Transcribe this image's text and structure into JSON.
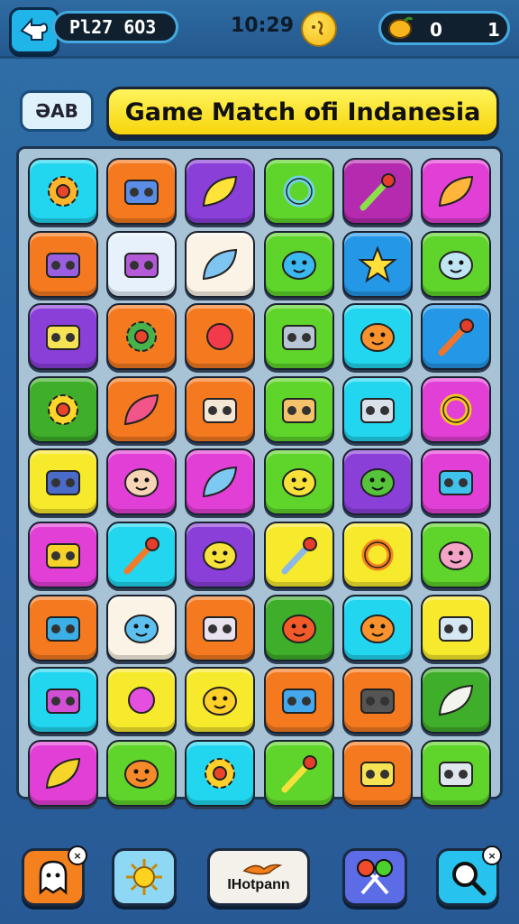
{
  "header": {
    "score_text": "Pl27 6O3",
    "clock_text": "10:29",
    "counter_left": "0",
    "counter_right": "1"
  },
  "abc_button_label": "ƏAB",
  "title": "Game Match ofi Indanesia",
  "colors": {
    "cyan": "#22d6ef",
    "orange": "#f57a1f",
    "purple": "#8a3fd8",
    "green": "#5fd42a",
    "magenta": "#e23fd6",
    "yellow": "#f7e92b",
    "pale": "#e6f1fb",
    "darkgreen": "#3fae2a",
    "deepblue": "#2497e6",
    "darkmagenta": "#b52bb0",
    "cream": "#fbf3e6"
  },
  "board": {
    "rows": 9,
    "cols": 6,
    "tiles": [
      {
        "color": "cyan",
        "icon": "flower-icon"
      },
      {
        "color": "orange",
        "icon": "robot-icon"
      },
      {
        "color": "purple",
        "icon": "banana-icon"
      },
      {
        "color": "green",
        "icon": "ring-icon"
      },
      {
        "color": "darkmagenta",
        "icon": "microphone-icon"
      },
      {
        "color": "magenta",
        "icon": "croissant-icon"
      },
      {
        "color": "orange",
        "icon": "suitcase-icon"
      },
      {
        "color": "pale",
        "icon": "bag-icon"
      },
      {
        "color": "cream",
        "icon": "feather-icon"
      },
      {
        "color": "green",
        "icon": "fish-face-icon"
      },
      {
        "color": "deepblue",
        "icon": "star-icon"
      },
      {
        "color": "green",
        "icon": "whale-face-icon"
      },
      {
        "color": "purple",
        "icon": "battery-icon"
      },
      {
        "color": "orange",
        "icon": "gear-icon"
      },
      {
        "color": "orange",
        "icon": "apple-icon"
      },
      {
        "color": "green",
        "icon": "camera-icon"
      },
      {
        "color": "cyan",
        "icon": "cookie-face-icon"
      },
      {
        "color": "deepblue",
        "icon": "pin-icon"
      },
      {
        "color": "darkgreen",
        "icon": "sun-icon"
      },
      {
        "color": "orange",
        "icon": "bone-icon"
      },
      {
        "color": "orange",
        "icon": "book-icon"
      },
      {
        "color": "green",
        "icon": "shop-icon"
      },
      {
        "color": "cyan",
        "icon": "dice-icon"
      },
      {
        "color": "magenta",
        "icon": "donut-icon"
      },
      {
        "color": "yellow",
        "icon": "radio-icon"
      },
      {
        "color": "magenta",
        "icon": "baby-face-icon"
      },
      {
        "color": "magenta",
        "icon": "leaf-icon"
      },
      {
        "color": "green",
        "icon": "blob-face-icon"
      },
      {
        "color": "purple",
        "icon": "frog-face-icon"
      },
      {
        "color": "magenta",
        "icon": "tv-icon"
      },
      {
        "color": "magenta",
        "icon": "boombox-icon"
      },
      {
        "color": "cyan",
        "icon": "brush-icon"
      },
      {
        "color": "purple",
        "icon": "cloud-face-icon"
      },
      {
        "color": "yellow",
        "icon": "mic-icon"
      },
      {
        "color": "yellow",
        "icon": "donut-ring-icon"
      },
      {
        "color": "green",
        "icon": "pig-face-icon"
      },
      {
        "color": "orange",
        "icon": "card-icon"
      },
      {
        "color": "cream",
        "icon": "monster-icon"
      },
      {
        "color": "orange",
        "icon": "oven-icon"
      },
      {
        "color": "darkgreen",
        "icon": "tomato-face-icon"
      },
      {
        "color": "cyan",
        "icon": "cookie-face-icon"
      },
      {
        "color": "yellow",
        "icon": "monitor-icon"
      },
      {
        "color": "cyan",
        "icon": "drum-icon"
      },
      {
        "color": "yellow",
        "icon": "balloon-icon"
      },
      {
        "color": "yellow",
        "icon": "bear-icon"
      },
      {
        "color": "orange",
        "icon": "chair-icon"
      },
      {
        "color": "orange",
        "icon": "lantern-icon"
      },
      {
        "color": "darkgreen",
        "icon": "cream-icon"
      },
      {
        "color": "magenta",
        "icon": "cheese-icon"
      },
      {
        "color": "green",
        "icon": "bun-face-icon"
      },
      {
        "color": "cyan",
        "icon": "sunflower-icon"
      },
      {
        "color": "green",
        "icon": "sword-icon"
      },
      {
        "color": "orange",
        "icon": "battery-icon"
      },
      {
        "color": "green",
        "icon": "tape-icon"
      }
    ]
  },
  "bottom_bar": {
    "hint_label": "IHotpann"
  }
}
